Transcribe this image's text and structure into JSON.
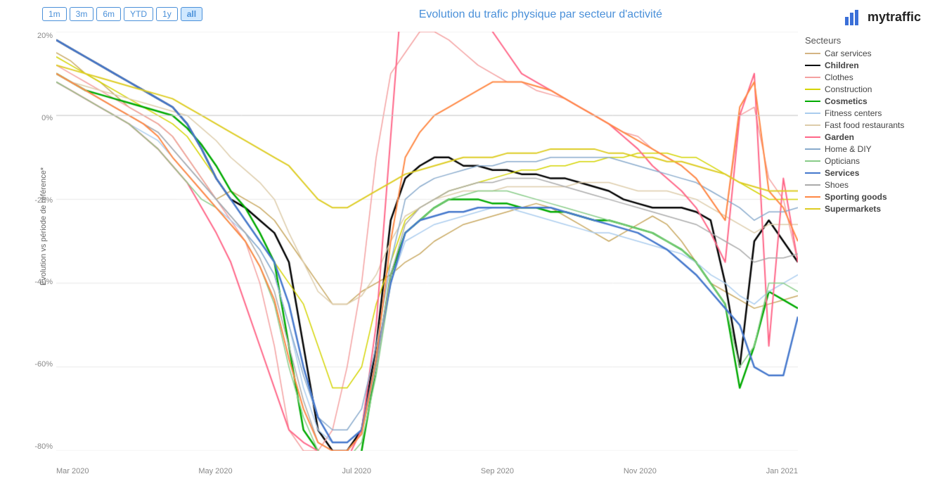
{
  "header": {
    "title": "Evolution du trafic physique par secteur d'activité",
    "logo_text": "mytraffic"
  },
  "time_buttons": [
    {
      "label": "1m",
      "active": false
    },
    {
      "label": "3m",
      "active": false
    },
    {
      "label": "6m",
      "active": false
    },
    {
      "label": "YTD",
      "active": false
    },
    {
      "label": "1y",
      "active": false
    },
    {
      "label": "all",
      "active": true
    }
  ],
  "legend": {
    "title": "Secteurs",
    "items": [
      {
        "label": "Car services",
        "color": "#d4b483",
        "bold": false
      },
      {
        "label": "Children",
        "color": "#000000",
        "bold": true
      },
      {
        "label": "Clothes",
        "color": "#f4a0a0",
        "bold": false
      },
      {
        "label": "Construction",
        "color": "#d4d400",
        "bold": false
      },
      {
        "label": "Cosmetics",
        "color": "#00aa00",
        "bold": true
      },
      {
        "label": "Fitness centers",
        "color": "#aaccee",
        "bold": false
      },
      {
        "label": "Fast food restaurants",
        "color": "#ddccaa",
        "bold": false
      },
      {
        "label": "Garden",
        "color": "#ff6688",
        "bold": true
      },
      {
        "label": "Home & DIY",
        "color": "#88aacc",
        "bold": false
      },
      {
        "label": "Opticians",
        "color": "#88cc88",
        "bold": false
      },
      {
        "label": "Services",
        "color": "#4477cc",
        "bold": true
      },
      {
        "label": "Shoes",
        "color": "#aaaaaa",
        "bold": false
      },
      {
        "label": "Sporting goods",
        "color": "#ff8844",
        "bold": true
      },
      {
        "label": "Supermarkets",
        "color": "#ddcc22",
        "bold": true
      }
    ]
  },
  "y_axis": {
    "labels": [
      "20%",
      "0%",
      "-20%",
      "-40%",
      "-60%",
      "-80%"
    ]
  },
  "x_axis": {
    "labels": [
      "Mar 2020",
      "May 2020",
      "Jul 2020",
      "Sep 2020",
      "Nov 2020",
      "Jan 2021"
    ]
  },
  "y_axis_label": "Evolution vs période de référence*"
}
